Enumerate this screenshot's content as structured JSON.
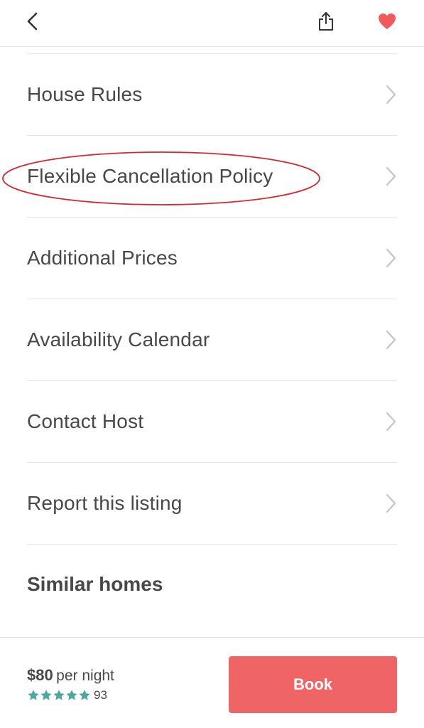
{
  "header": {
    "back_icon": "chevron-left-icon",
    "share_icon": "share-icon",
    "favorite_icon": "heart-icon",
    "favorite_color": "#f05a5a"
  },
  "menu": {
    "items": [
      {
        "label": "House Rules"
      },
      {
        "label": "Flexible Cancellation Policy"
      },
      {
        "label": "Additional Prices"
      },
      {
        "label": "Availability Calendar"
      },
      {
        "label": "Contact Host"
      },
      {
        "label": "Report this listing"
      }
    ],
    "highlight_color": "#d8262c"
  },
  "similar": {
    "title": "Similar homes"
  },
  "booking": {
    "price": "$80",
    "price_unit": "per night",
    "stars": 5,
    "star_color": "#4aa99c",
    "review_count": "93",
    "book_label": "Book",
    "button_color": "#ef6565"
  }
}
